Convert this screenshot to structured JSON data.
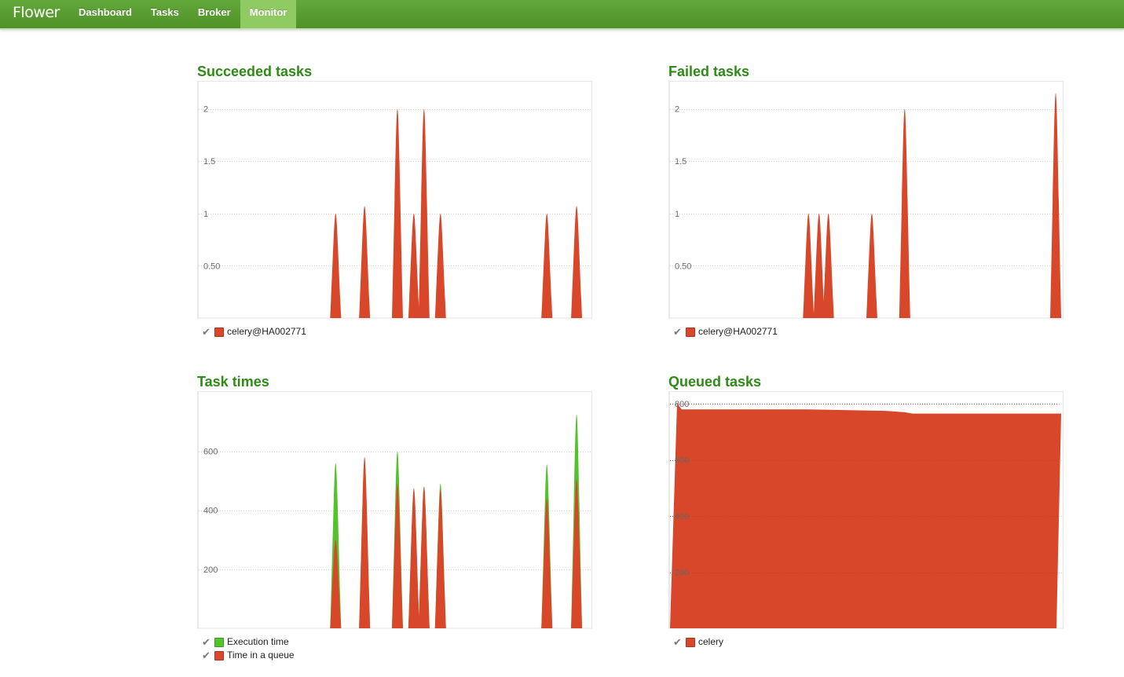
{
  "app": {
    "brand": "Flower"
  },
  "nav": {
    "items": [
      {
        "label": "Dashboard",
        "active": false
      },
      {
        "label": "Tasks",
        "active": false
      },
      {
        "label": "Broker",
        "active": false
      },
      {
        "label": "Monitor",
        "active": true
      }
    ]
  },
  "panels": {
    "succeeded": {
      "title": "Succeeded tasks",
      "legend": [
        {
          "label": "celery@HA002771",
          "color": "#d9472b"
        }
      ]
    },
    "failed": {
      "title": "Failed tasks",
      "legend": [
        {
          "label": "celery@HA002771",
          "color": "#d9472b"
        }
      ]
    },
    "times": {
      "title": "Task times",
      "legend": [
        {
          "label": "Execution time",
          "color": "#52c22d"
        },
        {
          "label": "Time in a queue",
          "color": "#d9472b"
        }
      ]
    },
    "queued": {
      "title": "Queued tasks",
      "legend": [
        {
          "label": "celery",
          "color": "#d9472b"
        }
      ]
    }
  },
  "chart_data": [
    {
      "id": "succeeded",
      "type": "area",
      "title": "Succeeded tasks",
      "ylim": [
        0,
        2.2
      ],
      "yticks": [
        0.5,
        1,
        1.5,
        2
      ],
      "yticklabels": [
        "0.50",
        "1",
        "1.5",
        "2"
      ],
      "series": [
        {
          "name": "celery@HA002771",
          "color": "#d9472b",
          "peaks": [
            {
              "t": 0.35,
              "v": 1
            },
            {
              "t": 0.424,
              "v": 1.07
            },
            {
              "t": 0.508,
              "v": 2
            },
            {
              "t": 0.55,
              "v": 1
            },
            {
              "t": 0.576,
              "v": 2
            },
            {
              "t": 0.618,
              "v": 1
            },
            {
              "t": 0.89,
              "v": 1
            },
            {
              "t": 0.966,
              "v": 1.07
            }
          ]
        }
      ]
    },
    {
      "id": "failed",
      "type": "area",
      "title": "Failed tasks",
      "ylim": [
        0,
        2.2
      ],
      "yticks": [
        0.5,
        1,
        1.5,
        2
      ],
      "yticklabels": [
        "0.50",
        "1",
        "1.5",
        "2"
      ],
      "series": [
        {
          "name": "celery@HA002771",
          "color": "#d9472b",
          "peaks": [
            {
              "t": 0.354,
              "v": 1
            },
            {
              "t": 0.381,
              "v": 1
            },
            {
              "t": 0.405,
              "v": 1
            },
            {
              "t": 0.516,
              "v": 1
            },
            {
              "t": 0.6,
              "v": 2
            },
            {
              "t": 0.986,
              "v": 2.15
            }
          ]
        }
      ]
    },
    {
      "id": "times",
      "type": "area",
      "title": "Task times",
      "ylim": [
        0,
        780
      ],
      "yticks": [
        200,
        400,
        600
      ],
      "yticklabels": [
        "200",
        "400",
        "600"
      ],
      "series": [
        {
          "name": "Execution time",
          "color": "#52c22d",
          "peaks": [
            {
              "t": 0.35,
              "v": 560
            },
            {
              "t": 0.424,
              "v": 570
            },
            {
              "t": 0.508,
              "v": 600
            },
            {
              "t": 0.55,
              "v": 470
            },
            {
              "t": 0.576,
              "v": 480
            },
            {
              "t": 0.618,
              "v": 490
            },
            {
              "t": 0.89,
              "v": 555
            },
            {
              "t": 0.966,
              "v": 725
            }
          ]
        },
        {
          "name": "Time in a queue",
          "color": "#d9472b",
          "peaks": [
            {
              "t": 0.35,
              "v": 300
            },
            {
              "t": 0.424,
              "v": 580
            },
            {
              "t": 0.508,
              "v": 490
            },
            {
              "t": 0.55,
              "v": 475
            },
            {
              "t": 0.576,
              "v": 480
            },
            {
              "t": 0.618,
              "v": 470
            },
            {
              "t": 0.89,
              "v": 440
            },
            {
              "t": 0.966,
              "v": 505
            }
          ]
        }
      ]
    },
    {
      "id": "queued",
      "type": "area",
      "title": "Queued tasks",
      "ylim": [
        0,
        820
      ],
      "yticks": [
        200,
        400,
        600,
        800
      ],
      "yticklabels": [
        "200",
        "400",
        "600",
        "800"
      ],
      "series": [
        {
          "name": "celery",
          "color": "#d9472b",
          "points": [
            {
              "t": 0.0,
              "v": 0
            },
            {
              "t": 0.018,
              "v": 800
            },
            {
              "t": 0.03,
              "v": 780
            },
            {
              "t": 0.35,
              "v": 780
            },
            {
              "t": 0.55,
              "v": 775
            },
            {
              "t": 0.6,
              "v": 770
            },
            {
              "t": 0.62,
              "v": 765
            },
            {
              "t": 1.0,
              "v": 765
            }
          ]
        }
      ]
    }
  ]
}
